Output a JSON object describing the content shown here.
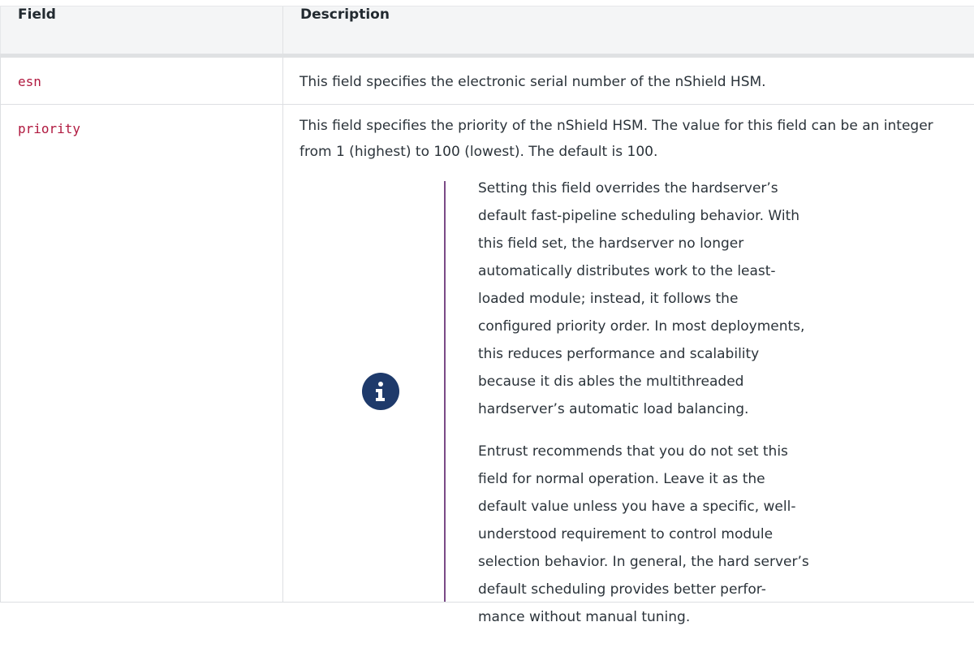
{
  "table": {
    "headers": {
      "field": "Field",
      "description": "Description"
    },
    "rows": [
      {
        "field": "esn",
        "description": "This field specifies the electronic serial number of the nShield HSM."
      },
      {
        "field": "priority",
        "description": "This field specifies the priority of the nShield HSM. The value for this field can be an integer from 1 (highest) to 100 (lowest). The default is 100."
      }
    ]
  },
  "note": {
    "icon": "info-icon",
    "colors": {
      "icon_bg": "#1e3a6b",
      "rule": "#7a4a86"
    },
    "paragraphs": [
      "Setting this field overrides the hardserver’s default fast-pipeline scheduling behavior. With this field set, the hardserver no longer automatically distributes work to the least-loaded module; instead, it follows the configured priority order. In most deployments, this reduces performance and scalability because it dis ables the multithreaded hardserver’s automatic load balancing.",
      "Entrust recommends that you do not set this field for normal operation. Leave it as the default value unless you have a specific, well-understood requirement to control module selection behavior. In general, the hard server’s default scheduling provides better perfor- mance without manual tuning."
    ]
  },
  "colors": {
    "code_text": "#b0193f",
    "header_bg": "#f4f5f6"
  }
}
